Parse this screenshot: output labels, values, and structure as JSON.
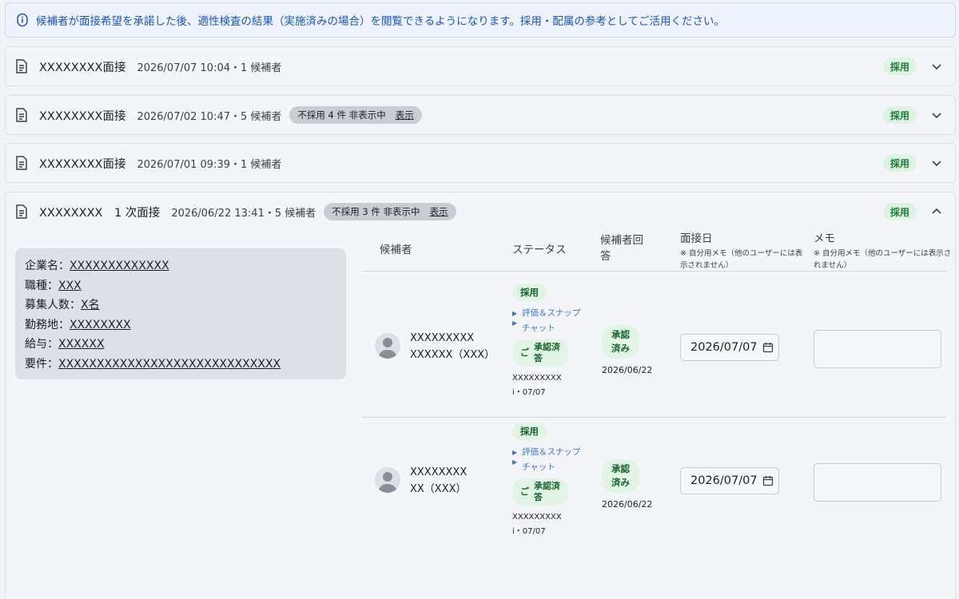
{
  "notice": {
    "text": "候補者が面接希望を承諾した後、適性検査の結果（実施済みの場合）を閲覧できるようになります。採用・配属の参考としてご活用ください。"
  },
  "interviews": [
    {
      "title": "XXXXXXXX面接",
      "meta": "2026/07/07 10:04・1 候補者",
      "badge": "採用"
    },
    {
      "title": "XXXXXXXX面接",
      "meta": "2026/07/02 10:47・5 候補者",
      "hidden_label": "不採用 4 件 非表示中",
      "show_label": "表示",
      "badge": "採用"
    },
    {
      "title": "XXXXXXXX面接",
      "meta": "2026/07/01 09:39・1 候補者",
      "badge": "採用"
    },
    {
      "title": "XXXXXXXX　1 次面接",
      "meta": "2026/06/22 13:41・5 候補者",
      "hidden_label": "不採用 3 件 非表示中",
      "show_label": "表示",
      "badge": "採用"
    }
  ],
  "company": {
    "name_label": "企業名：",
    "name_value": "XXXXXXXXXXXXX",
    "job_label": "職種：",
    "job_value": "XXX",
    "headcount_label": "募集人数：",
    "headcount_value": "X名",
    "location_label": "勤務地：",
    "location_value": "XXXXXXXX",
    "salary_label": "給与：",
    "salary_value": "XXXXXX",
    "req_label": "要件：",
    "req_value": "XXXXXXXXXXXXXXXXXXXXXXXXXXXXX"
  },
  "table": {
    "col_candidate": "候補者",
    "col_status": "ステータス",
    "col_reply_1": "候補者回",
    "col_reply_2": "答",
    "col_date": "面接日",
    "col_date_sub_1": "※ 自分用メモ（他のユーザーには表",
    "col_date_sub_2": "示されません）",
    "col_memo": "メモ",
    "col_memo_sub_1": "※ 自分用メモ（他のユーザーには表示さ",
    "col_memo_sub_2": "れません）"
  },
  "candidates": [
    {
      "name_1": "XXXXXXXXX",
      "name_2": "XXXXXX（XXX）",
      "status": "採用",
      "link_1": "評価＆スナップ",
      "link_2": "チャット",
      "approved_prefix": "ご",
      "approved_1": "承認済",
      "approved_2": "答",
      "meta_1": "XXXXXXXXX",
      "meta_2": "i・07/07",
      "reply_1": "承認",
      "reply_2": "済み",
      "reply_date": "2026/06/22",
      "interview_date": "2026/07/07"
    },
    {
      "name_1": "XXXXXXXX",
      "name_2": "XX（XXX）",
      "status": "採用",
      "link_1": "評価＆スナップ",
      "link_2": "チャット",
      "approved_prefix": "ご",
      "approved_1": "承認済",
      "approved_2": "答",
      "meta_1": "XXXXXXXXX",
      "meta_2": "i・07/07",
      "reply_1": "承認",
      "reply_2": "済み",
      "reply_date": "2026/06/22",
      "interview_date": "2026/07/07"
    }
  ],
  "colors": {
    "notice_text": "#1a56c4",
    "badge_green": "#188038",
    "link_blue": "#3c74d6"
  }
}
